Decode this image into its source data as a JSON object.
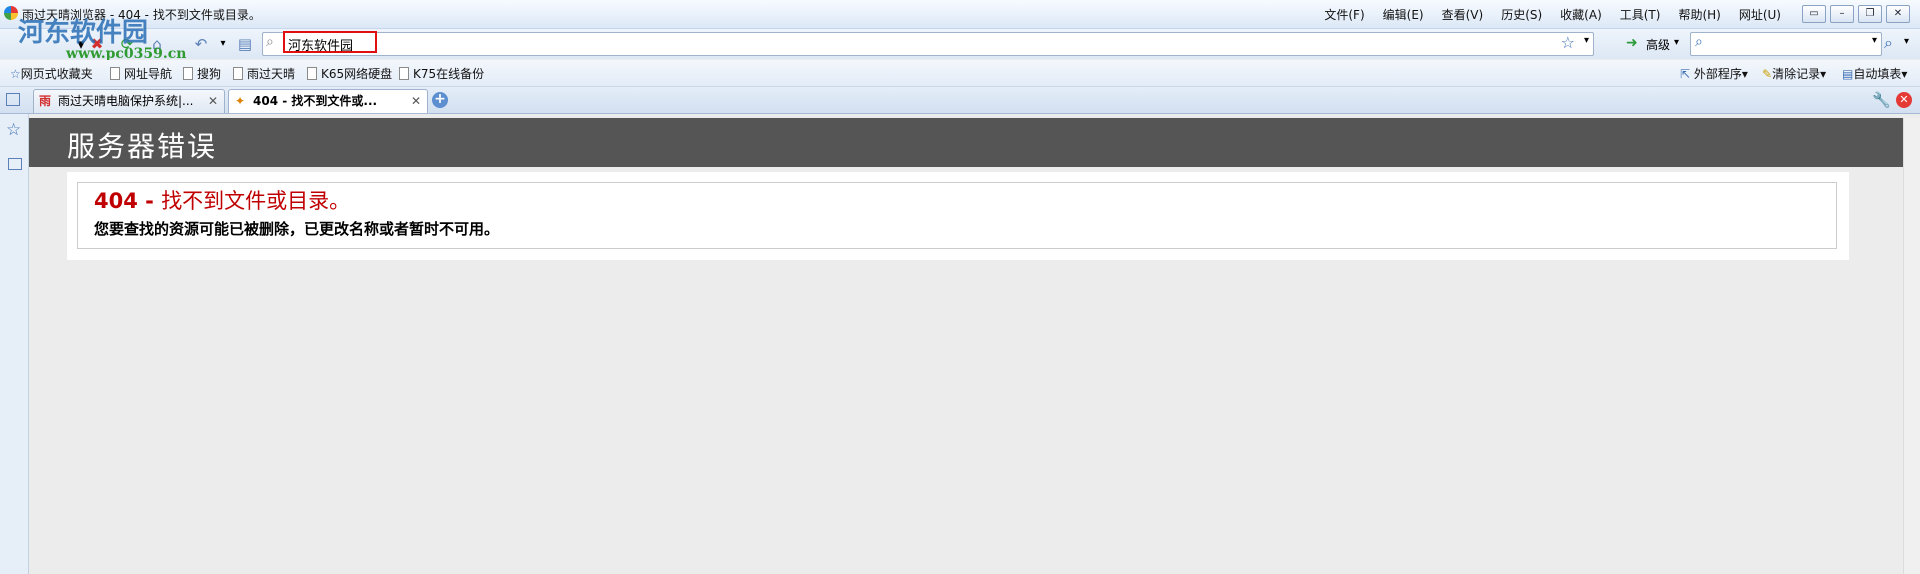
{
  "window": {
    "title": "雨过天晴浏览器 - 404 - 找不到文件或目录。",
    "menu": [
      "文件(F)",
      "编辑(E)",
      "查看(V)",
      "历史(S)",
      "收藏(A)",
      "工具(T)",
      "帮助(H)",
      "网址(U)"
    ],
    "controls": {
      "restore": "▭",
      "minimize": "–",
      "maximize": "❐",
      "close": "✕"
    }
  },
  "watermark": {
    "title": "河东软件园",
    "url": "www.pc0359.cn"
  },
  "address": {
    "value": "河东软件园",
    "advanced_label": "高级"
  },
  "favorites": {
    "items": [
      "网页式收藏夹",
      "网址导航",
      "搜狗",
      "雨过天晴",
      "K65网络硬盘",
      "K75在线备份"
    ],
    "right": [
      "外部程序",
      "清除记录",
      "自动填表"
    ]
  },
  "tabs": [
    {
      "label": "雨过天晴电脑保护系统|...",
      "active": false,
      "icon_text": "雨"
    },
    {
      "label": "404 - 找不到文件或...",
      "active": true
    }
  ],
  "page": {
    "header": "服务器错误",
    "error_code": "404 - ",
    "error_title": "找不到文件或目录。",
    "error_desc": "您要查找的资源可能已被删除，已更改名称或者暂时不可用。"
  },
  "colors": {
    "accent": "#c00000",
    "header_bg": "#555555",
    "highlight": "#e01010"
  }
}
